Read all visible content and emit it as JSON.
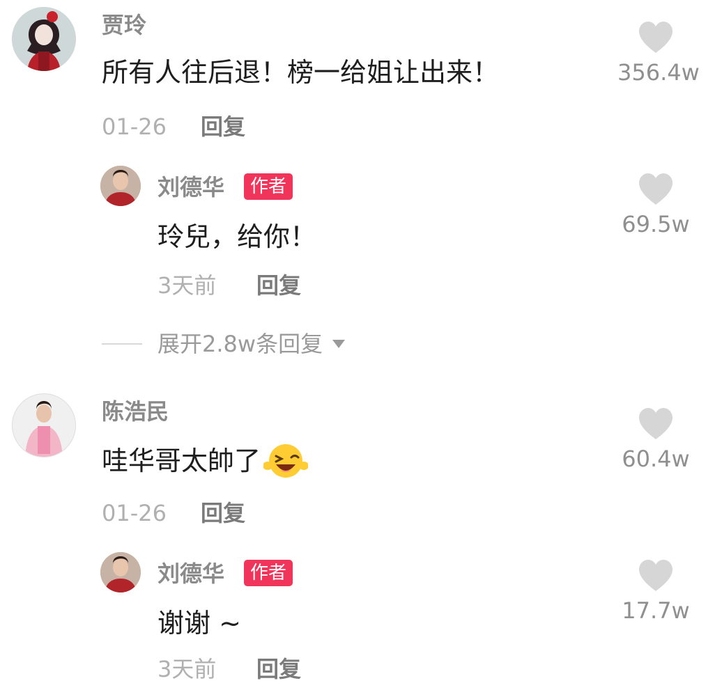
{
  "comments": [
    {
      "username": "贾玲",
      "text": "所有人往后退！榜一给姐让出来！",
      "date": "01-26",
      "reply_label": "回复",
      "likes": "356.4w",
      "avatar_icon": "avatar-girl-red-outfit",
      "replies": [
        {
          "username": "刘德华",
          "badge": "作者",
          "text": "玲兒，给你！",
          "date": "3天前",
          "reply_label": "回复",
          "likes": "69.5w",
          "avatar_icon": "avatar-man-red-jacket"
        }
      ],
      "expand_label": "展开2.8w条回复"
    },
    {
      "username": "陈浩民",
      "text": "哇华哥太帥了",
      "emoji": "laughing-wink-emoji",
      "date": "01-26",
      "reply_label": "回复",
      "likes": "60.4w",
      "avatar_icon": "avatar-man-pink-shirt",
      "replies": [
        {
          "username": "刘德华",
          "badge": "作者",
          "text": "谢谢 ~",
          "date": "3天前",
          "reply_label": "回复",
          "likes": "17.7w",
          "avatar_icon": "avatar-man-red-jacket"
        }
      ]
    }
  ],
  "colors": {
    "badge": "#f0345a",
    "heart": "#d6d6d6",
    "name": "#8a8a8a",
    "text": "#1e1e1e",
    "meta": "#b0b0b0"
  }
}
